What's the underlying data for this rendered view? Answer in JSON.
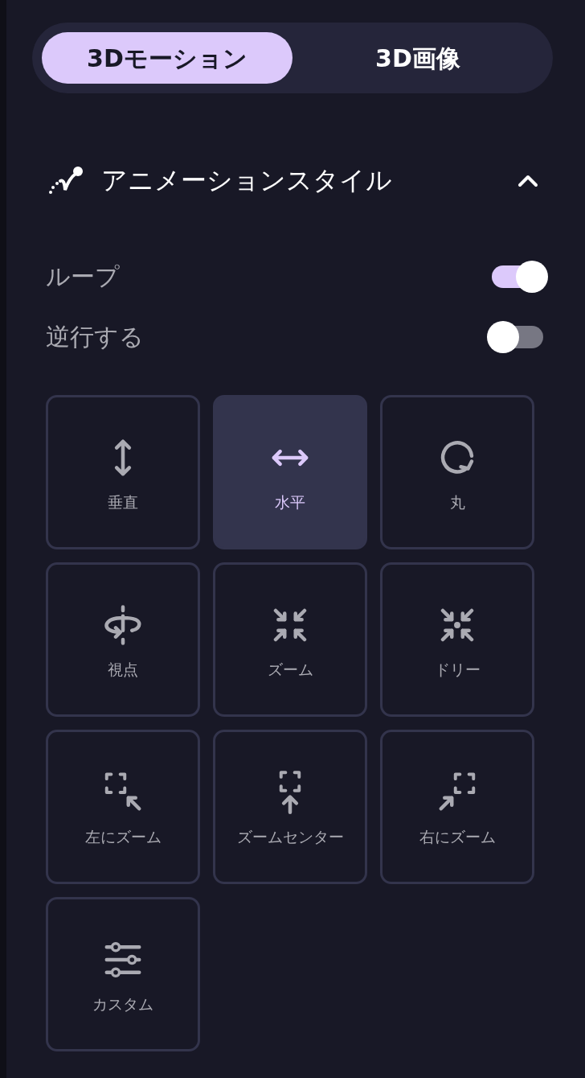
{
  "tabs": [
    {
      "label": "3Dモーション",
      "selected": true
    },
    {
      "label": "3D画像",
      "selected": false
    }
  ],
  "section": {
    "title": "アニメーションスタイル",
    "expanded": true
  },
  "toggles": [
    {
      "label": "ループ",
      "on": true
    },
    {
      "label": "逆行する",
      "on": false
    }
  ],
  "styles": [
    {
      "label": "垂直",
      "selected": false
    },
    {
      "label": "水平",
      "selected": true
    },
    {
      "label": "丸",
      "selected": false
    },
    {
      "label": "視点",
      "selected": false
    },
    {
      "label": "ズーム",
      "selected": false
    },
    {
      "label": "ドリー",
      "selected": false
    },
    {
      "label": "左にズーム",
      "selected": false
    },
    {
      "label": "ズームセンター",
      "selected": false
    },
    {
      "label": "右にズーム",
      "selected": false
    },
    {
      "label": "カスタム",
      "selected": false
    }
  ]
}
